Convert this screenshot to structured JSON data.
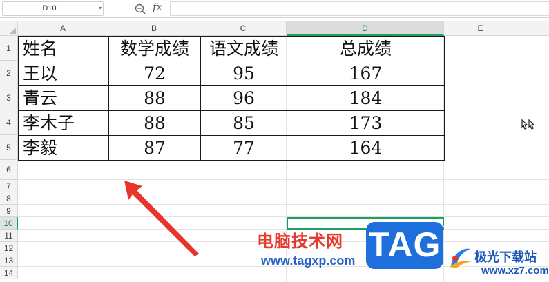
{
  "formula_bar": {
    "cell_reference": "D10",
    "fx_label": "fx",
    "formula_value": ""
  },
  "columns": [
    "A",
    "B",
    "C",
    "D",
    "E"
  ],
  "active_column": "D",
  "rows": [
    "1",
    "2",
    "3",
    "4",
    "5",
    "6",
    "7",
    "8",
    "9",
    "10",
    "11",
    "12",
    "13",
    "14"
  ],
  "active_row": "10",
  "table": {
    "headers": [
      "姓名",
      "数学成绩",
      "语文成绩",
      "总成绩"
    ],
    "records": [
      [
        "王以",
        "72",
        "95",
        "167"
      ],
      [
        "青云",
        "88",
        "96",
        "184"
      ],
      [
        "李木子",
        "88",
        "85",
        "173"
      ],
      [
        "李毅",
        "87",
        "77",
        "164"
      ]
    ]
  },
  "selection": {
    "cell": "D10",
    "color": "#1f9d62"
  },
  "arrow_color": "#e8342b",
  "watermark": {
    "site_name_cn": "电脑技术网",
    "site_url": "www.tagxp.com",
    "tag": "TAG",
    "brand_cn": "极光下载站",
    "brand_url": "www.xz7.com"
  }
}
